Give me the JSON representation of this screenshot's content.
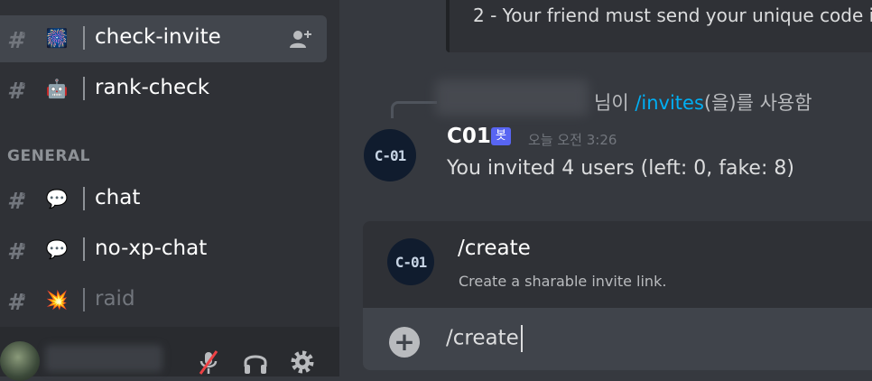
{
  "sidebar": {
    "channels": [
      {
        "name": "check-invite",
        "emoji": "🎆"
      },
      {
        "name": "rank-check",
        "emoji": "🤖"
      },
      {
        "name": "chat",
        "emoji": "💬"
      },
      {
        "name": "no-xp-chat",
        "emoji": "💬"
      },
      {
        "name": "raid",
        "emoji": "💥"
      }
    ],
    "category": "GENERAL"
  },
  "chat": {
    "quote_text": "2 - Your friend must send your unique code in",
    "reply_prefix": "님이 ",
    "reply_command": "/invites",
    "reply_suffix": "(을)를 사용함",
    "author": "C01",
    "bot_badge": "봇",
    "timestamp": "오늘 오전 3:26",
    "message": "You invited 4 users (left: 0, fake: 8)",
    "bot_avatar_text": "C-01"
  },
  "command_popup": {
    "name": "/create",
    "description": "Create a sharable invite link."
  },
  "composer": {
    "value": "/create"
  },
  "icons": {
    "add_member": "add-member-icon",
    "mute": "microphone-muted-icon",
    "headset": "headphones-icon",
    "settings": "gear-icon",
    "plus": "plus-circle-icon"
  }
}
